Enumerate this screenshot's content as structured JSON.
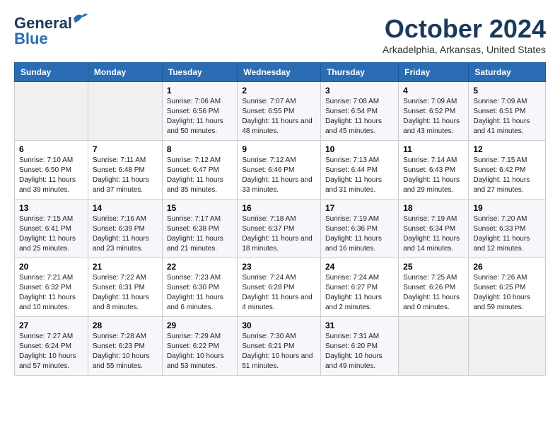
{
  "logo": {
    "line1": "General",
    "line2": "Blue"
  },
  "title": "October 2024",
  "subtitle": "Arkadelphia, Arkansas, United States",
  "days_of_week": [
    "Sunday",
    "Monday",
    "Tuesday",
    "Wednesday",
    "Thursday",
    "Friday",
    "Saturday"
  ],
  "weeks": [
    [
      {
        "day": "",
        "info": ""
      },
      {
        "day": "",
        "info": ""
      },
      {
        "day": "1",
        "info": "Sunrise: 7:06 AM\nSunset: 6:56 PM\nDaylight: 11 hours and 50 minutes."
      },
      {
        "day": "2",
        "info": "Sunrise: 7:07 AM\nSunset: 6:55 PM\nDaylight: 11 hours and 48 minutes."
      },
      {
        "day": "3",
        "info": "Sunrise: 7:08 AM\nSunset: 6:54 PM\nDaylight: 11 hours and 45 minutes."
      },
      {
        "day": "4",
        "info": "Sunrise: 7:09 AM\nSunset: 6:52 PM\nDaylight: 11 hours and 43 minutes."
      },
      {
        "day": "5",
        "info": "Sunrise: 7:09 AM\nSunset: 6:51 PM\nDaylight: 11 hours and 41 minutes."
      }
    ],
    [
      {
        "day": "6",
        "info": "Sunrise: 7:10 AM\nSunset: 6:50 PM\nDaylight: 11 hours and 39 minutes."
      },
      {
        "day": "7",
        "info": "Sunrise: 7:11 AM\nSunset: 6:48 PM\nDaylight: 11 hours and 37 minutes."
      },
      {
        "day": "8",
        "info": "Sunrise: 7:12 AM\nSunset: 6:47 PM\nDaylight: 11 hours and 35 minutes."
      },
      {
        "day": "9",
        "info": "Sunrise: 7:12 AM\nSunset: 6:46 PM\nDaylight: 11 hours and 33 minutes."
      },
      {
        "day": "10",
        "info": "Sunrise: 7:13 AM\nSunset: 6:44 PM\nDaylight: 11 hours and 31 minutes."
      },
      {
        "day": "11",
        "info": "Sunrise: 7:14 AM\nSunset: 6:43 PM\nDaylight: 11 hours and 29 minutes."
      },
      {
        "day": "12",
        "info": "Sunrise: 7:15 AM\nSunset: 6:42 PM\nDaylight: 11 hours and 27 minutes."
      }
    ],
    [
      {
        "day": "13",
        "info": "Sunrise: 7:15 AM\nSunset: 6:41 PM\nDaylight: 11 hours and 25 minutes."
      },
      {
        "day": "14",
        "info": "Sunrise: 7:16 AM\nSunset: 6:39 PM\nDaylight: 11 hours and 23 minutes."
      },
      {
        "day": "15",
        "info": "Sunrise: 7:17 AM\nSunset: 6:38 PM\nDaylight: 11 hours and 21 minutes."
      },
      {
        "day": "16",
        "info": "Sunrise: 7:18 AM\nSunset: 6:37 PM\nDaylight: 11 hours and 18 minutes."
      },
      {
        "day": "17",
        "info": "Sunrise: 7:19 AM\nSunset: 6:36 PM\nDaylight: 11 hours and 16 minutes."
      },
      {
        "day": "18",
        "info": "Sunrise: 7:19 AM\nSunset: 6:34 PM\nDaylight: 11 hours and 14 minutes."
      },
      {
        "day": "19",
        "info": "Sunrise: 7:20 AM\nSunset: 6:33 PM\nDaylight: 11 hours and 12 minutes."
      }
    ],
    [
      {
        "day": "20",
        "info": "Sunrise: 7:21 AM\nSunset: 6:32 PM\nDaylight: 11 hours and 10 minutes."
      },
      {
        "day": "21",
        "info": "Sunrise: 7:22 AM\nSunset: 6:31 PM\nDaylight: 11 hours and 8 minutes."
      },
      {
        "day": "22",
        "info": "Sunrise: 7:23 AM\nSunset: 6:30 PM\nDaylight: 11 hours and 6 minutes."
      },
      {
        "day": "23",
        "info": "Sunrise: 7:24 AM\nSunset: 6:28 PM\nDaylight: 11 hours and 4 minutes."
      },
      {
        "day": "24",
        "info": "Sunrise: 7:24 AM\nSunset: 6:27 PM\nDaylight: 11 hours and 2 minutes."
      },
      {
        "day": "25",
        "info": "Sunrise: 7:25 AM\nSunset: 6:26 PM\nDaylight: 11 hours and 0 minutes."
      },
      {
        "day": "26",
        "info": "Sunrise: 7:26 AM\nSunset: 6:25 PM\nDaylight: 10 hours and 59 minutes."
      }
    ],
    [
      {
        "day": "27",
        "info": "Sunrise: 7:27 AM\nSunset: 6:24 PM\nDaylight: 10 hours and 57 minutes."
      },
      {
        "day": "28",
        "info": "Sunrise: 7:28 AM\nSunset: 6:23 PM\nDaylight: 10 hours and 55 minutes."
      },
      {
        "day": "29",
        "info": "Sunrise: 7:29 AM\nSunset: 6:22 PM\nDaylight: 10 hours and 53 minutes."
      },
      {
        "day": "30",
        "info": "Sunrise: 7:30 AM\nSunset: 6:21 PM\nDaylight: 10 hours and 51 minutes."
      },
      {
        "day": "31",
        "info": "Sunrise: 7:31 AM\nSunset: 6:20 PM\nDaylight: 10 hours and 49 minutes."
      },
      {
        "day": "",
        "info": ""
      },
      {
        "day": "",
        "info": ""
      }
    ]
  ]
}
